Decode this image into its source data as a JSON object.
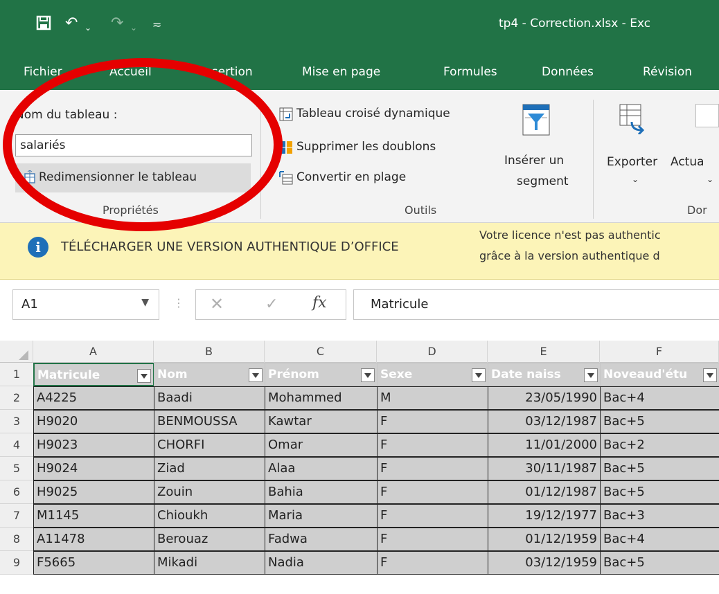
{
  "title_bar": {
    "doc_title": "tp4 - Correction.xlsx  -  Exc",
    "save_icon": "save-icon",
    "undo_icon": "undo-icon",
    "redo_icon": "redo-icon",
    "customize_icon": "customize-icon",
    "brand_color": "#217346"
  },
  "tabs": [
    "Fichier",
    "Accueil",
    "Insertion",
    "Mise en page",
    "Formules",
    "Données",
    "Révision"
  ],
  "ribbon": {
    "properties": {
      "name_label": "Nom du tableau :",
      "name_value": "salariés",
      "resize_label": "Redimensionner le tableau",
      "group_label": "Propriétés"
    },
    "tools": {
      "pivot_label": "Tableau croisé dynamique",
      "dedupe_label": "Supprimer les doublons",
      "convert_label": "Convertir en plage",
      "slicer_line1": "Insérer un",
      "slicer_line2": "segment",
      "group_label": "Outils"
    },
    "external": {
      "export_label": "Exporter",
      "refresh_label": "Actua",
      "group_label": "Dor"
    }
  },
  "info_bar": {
    "title": "TÉLÉCHARGER UNE VERSION AUTHENTIQUE D’OFFICE",
    "message_line1": "Votre licence n'est pas authentic",
    "message_line2": "grâce à la version authentique d"
  },
  "formula_bar": {
    "name_box": "A1",
    "fx": "fx",
    "formula": "Matricule"
  },
  "grid": {
    "columns": [
      "A",
      "B",
      "C",
      "D",
      "E",
      "F"
    ],
    "headers": [
      "Matricule",
      "Nom",
      "Prénom",
      "Sexe",
      "Date naiss",
      "Noveaud'étu"
    ],
    "row_numbers": [
      "1",
      "2",
      "3",
      "4",
      "5",
      "6",
      "7",
      "8",
      "9"
    ],
    "rows": [
      [
        "A4225",
        "Baadi",
        "Mohammed",
        "M",
        "23/05/1990",
        "Bac+4"
      ],
      [
        "H9020",
        "BENMOUSSA",
        "Kawtar",
        "F",
        "03/12/1987",
        "Bac+5"
      ],
      [
        "H9023",
        "CHORFI",
        "Omar",
        "F",
        "11/01/2000",
        "Bac+2"
      ],
      [
        "H9024",
        "Ziad",
        "Alaa",
        "F",
        "30/11/1987",
        "Bac+5"
      ],
      [
        "H9025",
        "Zouin",
        "Bahia",
        "F",
        "01/12/1987",
        "Bac+5"
      ],
      [
        "M1145",
        "Chioukh",
        "Maria",
        "F",
        "19/12/1977",
        "Bac+3"
      ],
      [
        "A11478",
        "Berouaz",
        "Fadwa",
        "F",
        "01/12/1959",
        "Bac+4"
      ],
      [
        "F5665",
        "Mikadi",
        "Nadia",
        "F",
        "03/12/1959",
        "Bac+5"
      ]
    ]
  },
  "annotation_color": "#e50000"
}
